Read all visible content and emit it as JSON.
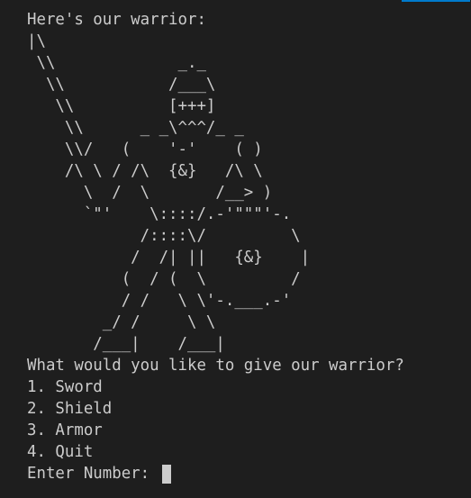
{
  "colors": {
    "background": "#1e1e1e",
    "text": "#cccccc",
    "accent": "#007acc"
  },
  "terminal": {
    "header": "Here's our warrior:",
    "ascii_art": "|\\\n \\\\             _._\n  \\\\           /___\\\n   \\\\          [+++]\n    \\\\      _ _\\^^^/_ _\n    \\\\/   (    '-'    ( )\n    /\\ \\ / /\\  {&}   /\\ \\\n      \\  /  \\       /__> )\n      `\"'    \\::::/.-'\"\"\"'-.\n            /::::\\/         \\\n           /  /| ||   {&}    |\n          (  / (  \\         /\n          / /   \\ \\'-.___.-'\n        _/ /     \\ \\\n       /___|    /___|",
    "question": "What would you like to give our warrior?",
    "menu": [
      "1. Sword",
      "2. Shield",
      "3. Armor",
      "4. Quit"
    ],
    "input_prompt": "Enter Number: "
  }
}
